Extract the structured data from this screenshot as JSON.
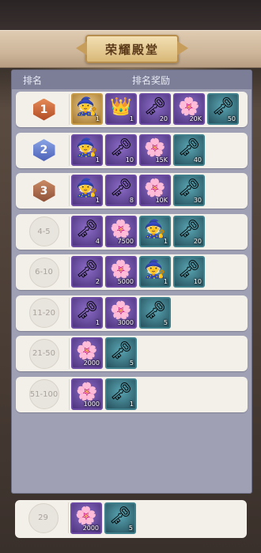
{
  "title": "荣耀殿堂",
  "header": {
    "rank_col": "排名",
    "reward_col": "排名奖励"
  },
  "rows": [
    {
      "rank": "1",
      "items": [
        {
          "icon": "gold-hat-icon",
          "glyph": "🧙",
          "style": "gold",
          "qty": "1"
        },
        {
          "icon": "crown-chest-icon",
          "glyph": "👑",
          "style": "purple",
          "qty": "1"
        },
        {
          "icon": "gold-key-icon",
          "glyph": "🗝",
          "style": "purple",
          "qty": "20"
        },
        {
          "icon": "purple-flower-icon",
          "glyph": "🌸",
          "style": "purple",
          "qty": "20K"
        },
        {
          "icon": "silver-key-icon",
          "glyph": "🗝",
          "style": "teal",
          "qty": "50"
        }
      ]
    },
    {
      "rank": "2",
      "items": [
        {
          "icon": "purple-hat-icon",
          "glyph": "🧙",
          "style": "purple",
          "qty": "1"
        },
        {
          "icon": "gold-key-icon",
          "glyph": "🗝",
          "style": "purple",
          "qty": "10"
        },
        {
          "icon": "purple-flower-icon",
          "glyph": "🌸",
          "style": "purple",
          "qty": "15K"
        },
        {
          "icon": "silver-key-icon",
          "glyph": "🗝",
          "style": "teal",
          "qty": "40"
        }
      ]
    },
    {
      "rank": "3",
      "items": [
        {
          "icon": "purple-hat-icon",
          "glyph": "🧙",
          "style": "purple",
          "qty": "1"
        },
        {
          "icon": "gold-key-icon",
          "glyph": "🗝",
          "style": "purple",
          "qty": "8"
        },
        {
          "icon": "purple-flower-icon",
          "glyph": "🌸",
          "style": "purple",
          "qty": "10K"
        },
        {
          "icon": "silver-key-icon",
          "glyph": "🗝",
          "style": "teal",
          "qty": "30"
        }
      ]
    },
    {
      "rank": "4-5",
      "items": [
        {
          "icon": "gold-key-icon",
          "glyph": "🗝",
          "style": "purple",
          "qty": "4"
        },
        {
          "icon": "purple-flower-icon",
          "glyph": "🌸",
          "style": "purple",
          "qty": "7500"
        },
        {
          "icon": "blue-hat-icon",
          "glyph": "🧙",
          "style": "teal",
          "qty": "1"
        },
        {
          "icon": "silver-key-icon",
          "glyph": "🗝",
          "style": "teal",
          "qty": "20"
        }
      ]
    },
    {
      "rank": "6-10",
      "items": [
        {
          "icon": "gold-key-icon",
          "glyph": "🗝",
          "style": "purple",
          "qty": "2"
        },
        {
          "icon": "purple-flower-icon",
          "glyph": "🌸",
          "style": "purple",
          "qty": "5000"
        },
        {
          "icon": "blue-hat-icon",
          "glyph": "🧙",
          "style": "teal",
          "qty": "1"
        },
        {
          "icon": "silver-key-icon",
          "glyph": "🗝",
          "style": "teal",
          "qty": "10"
        }
      ]
    },
    {
      "rank": "11-20",
      "items": [
        {
          "icon": "gold-key-icon",
          "glyph": "🗝",
          "style": "purple",
          "qty": "1"
        },
        {
          "icon": "purple-flower-icon",
          "glyph": "🌸",
          "style": "purple",
          "qty": "3000"
        },
        {
          "icon": "silver-key-icon",
          "glyph": "🗝",
          "style": "teal",
          "qty": "5"
        }
      ]
    },
    {
      "rank": "21-50",
      "items": [
        {
          "icon": "purple-flower-icon",
          "glyph": "🌸",
          "style": "purple",
          "qty": "2000"
        },
        {
          "icon": "silver-key-icon",
          "glyph": "🗝",
          "style": "teal",
          "qty": "5"
        }
      ]
    },
    {
      "rank": "51-100",
      "items": [
        {
          "icon": "purple-flower-icon",
          "glyph": "🌸",
          "style": "purple",
          "qty": "1000"
        },
        {
          "icon": "silver-key-icon",
          "glyph": "🗝",
          "style": "teal",
          "qty": "1"
        }
      ]
    }
  ],
  "my_rank": {
    "rank": "29",
    "items": [
      {
        "icon": "purple-flower-icon",
        "glyph": "🌸",
        "style": "purple",
        "qty": "2000"
      },
      {
        "icon": "silver-key-icon",
        "glyph": "🗝",
        "style": "teal",
        "qty": "5"
      }
    ]
  }
}
